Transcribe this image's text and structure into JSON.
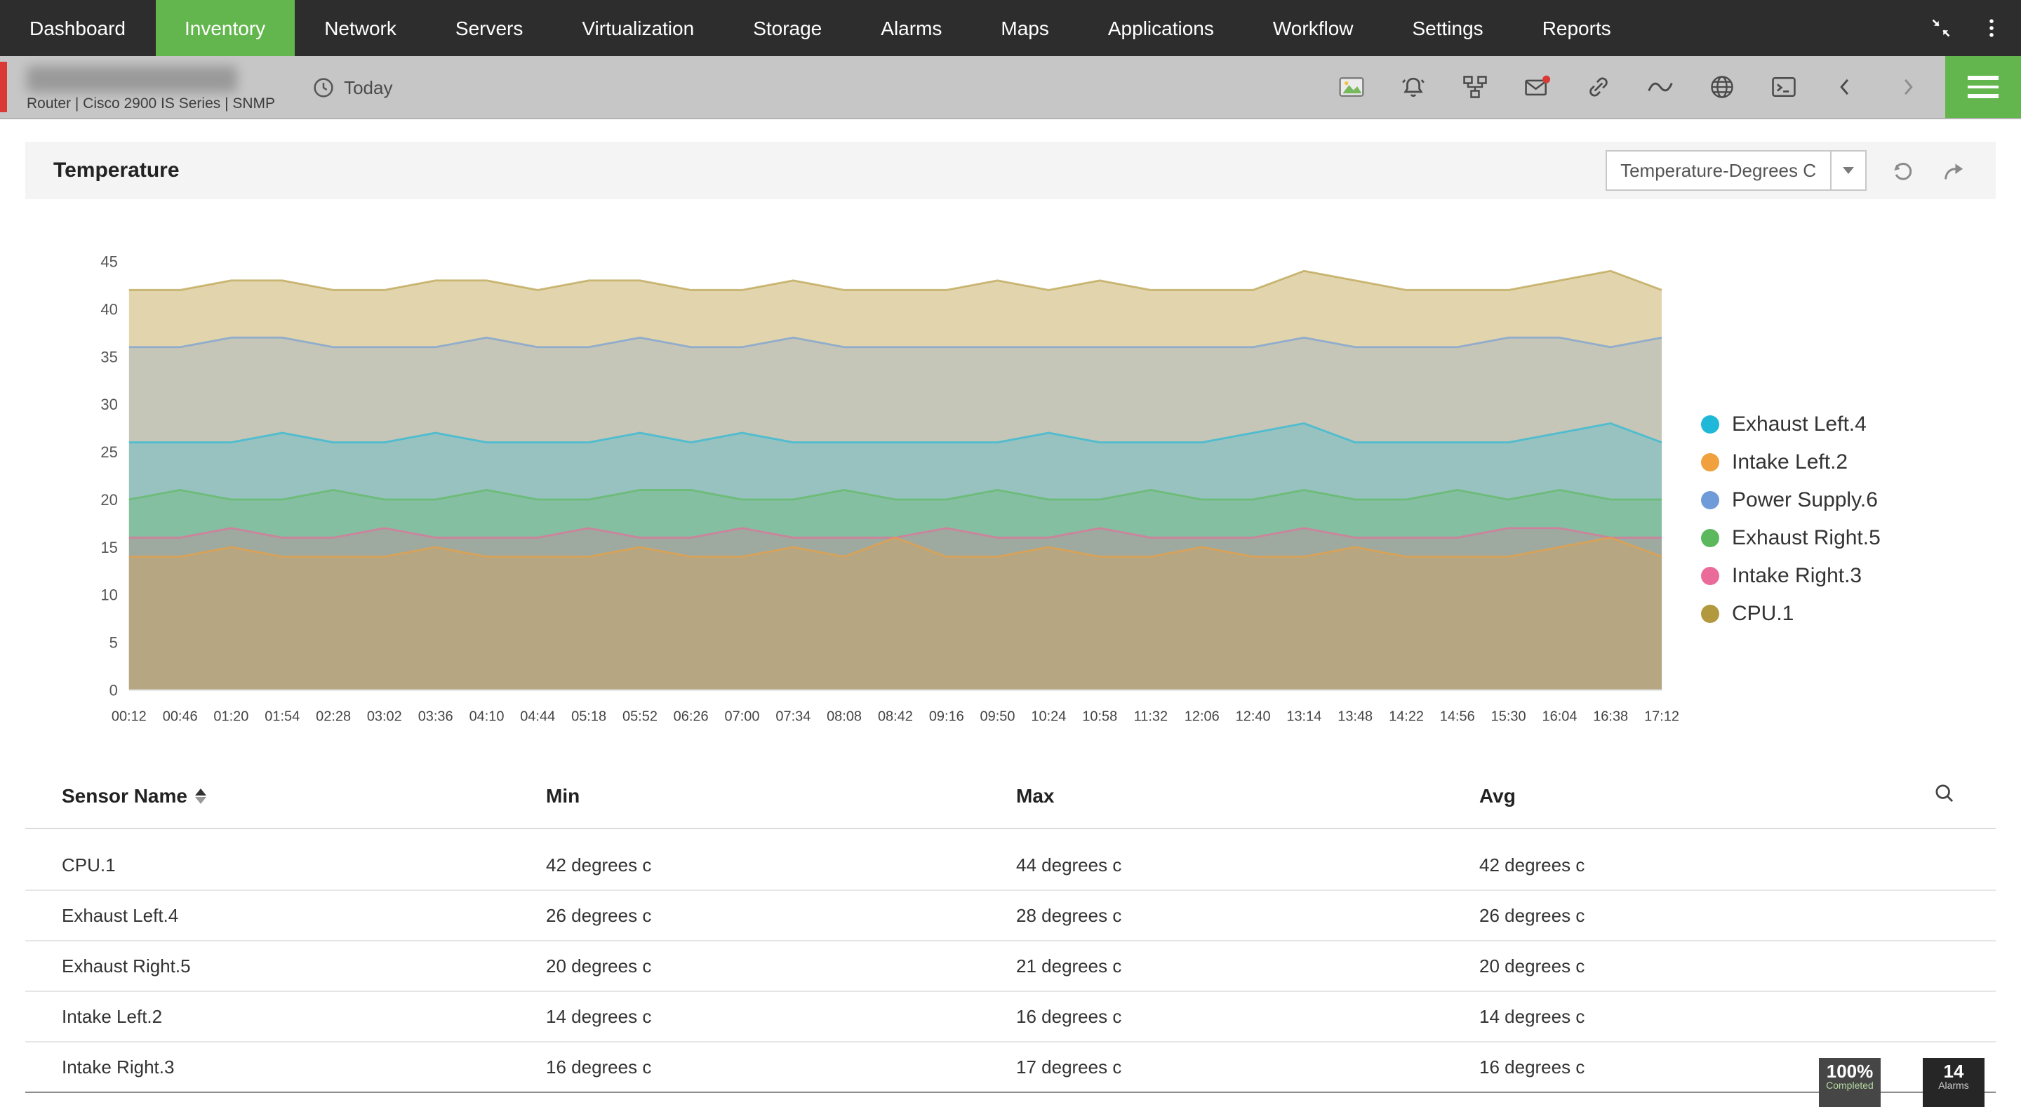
{
  "theme": {
    "accent_green": "#63b64d",
    "accent_red": "#d93a36",
    "nav_bg": "#2d2d2d",
    "subheader_bg": "#c6c6c6"
  },
  "nav": {
    "items": [
      "Dashboard",
      "Inventory",
      "Network",
      "Servers",
      "Virtualization",
      "Storage",
      "Alarms",
      "Maps",
      "Applications",
      "Workflow",
      "Settings",
      "Reports"
    ],
    "active": "Inventory",
    "icons": [
      "collapse-icon",
      "kebab-menu-icon"
    ]
  },
  "subheader": {
    "device_info": "Router | Cisco 2900 IS Series  | SNMP",
    "time_filter": "Today",
    "icons": [
      "image-icon",
      "alarm-bell-icon",
      "topology-icon",
      "mail-icon",
      "link-icon",
      "sparkline-icon",
      "globe-icon",
      "terminal-icon",
      "chevron-left-icon",
      "chevron-right-icon",
      "menu-icon"
    ],
    "mail_has_notification": true
  },
  "panel": {
    "title": "Temperature",
    "dropdown_value": "Temperature-Degrees C",
    "control_icons": [
      "refresh-icon",
      "export-icon"
    ]
  },
  "chart_data": {
    "type": "area",
    "title": "Temperature",
    "unit": "degrees C",
    "ylim": [
      0,
      45
    ],
    "yticks": [
      0,
      5,
      10,
      15,
      20,
      25,
      30,
      35,
      40,
      45
    ],
    "grid": false,
    "legend_position": "right",
    "x": [
      "00:12",
      "00:46",
      "01:20",
      "01:54",
      "02:28",
      "03:02",
      "03:36",
      "04:10",
      "04:44",
      "05:18",
      "05:52",
      "06:26",
      "07:00",
      "07:34",
      "08:08",
      "08:42",
      "09:16",
      "09:50",
      "10:24",
      "10:58",
      "11:32",
      "12:06",
      "12:40",
      "13:14",
      "13:48",
      "14:22",
      "14:56",
      "15:30",
      "16:04",
      "16:38",
      "17:12"
    ],
    "series": [
      {
        "name": "Exhaust Left.4",
        "color": "#1fb8d8",
        "fill": "rgba(31,184,216,0.28)",
        "values": [
          26,
          26,
          26,
          27,
          26,
          26,
          27,
          26,
          26,
          26,
          27,
          26,
          27,
          26,
          26,
          26,
          26,
          26,
          27,
          26,
          26,
          26,
          27,
          28,
          26,
          26,
          26,
          26,
          27,
          28,
          26
        ]
      },
      {
        "name": "Intake Left.2",
        "color": "#f0a03c",
        "fill": "rgba(240,160,60,0.30)",
        "values": [
          14,
          14,
          15,
          14,
          14,
          14,
          15,
          14,
          14,
          14,
          15,
          14,
          14,
          15,
          14,
          16,
          14,
          14,
          15,
          14,
          14,
          15,
          14,
          14,
          15,
          14,
          14,
          14,
          15,
          16,
          14
        ]
      },
      {
        "name": "Power Supply.6",
        "color": "#6f9bd8",
        "fill": "rgba(111,155,216,0.25)",
        "values": [
          36,
          36,
          37,
          37,
          36,
          36,
          36,
          37,
          36,
          36,
          37,
          36,
          36,
          37,
          36,
          36,
          36,
          36,
          36,
          36,
          36,
          36,
          36,
          37,
          36,
          36,
          36,
          37,
          37,
          36,
          37
        ]
      },
      {
        "name": "Exhaust Right.5",
        "color": "#5cb85c",
        "fill": "rgba(92,184,92,0.30)",
        "values": [
          20,
          21,
          20,
          20,
          21,
          20,
          20,
          21,
          20,
          20,
          21,
          21,
          20,
          20,
          21,
          20,
          20,
          21,
          20,
          20,
          21,
          20,
          20,
          21,
          20,
          20,
          21,
          20,
          21,
          20,
          20
        ]
      },
      {
        "name": "Intake Right.3",
        "color": "#ea6a9a",
        "fill": "rgba(234,106,154,0.25)",
        "values": [
          16,
          16,
          17,
          16,
          16,
          17,
          16,
          16,
          16,
          17,
          16,
          16,
          17,
          16,
          16,
          16,
          17,
          16,
          16,
          17,
          16,
          16,
          16,
          17,
          16,
          16,
          16,
          17,
          17,
          16,
          16
        ]
      },
      {
        "name": "CPU.1",
        "color": "#b3993d",
        "fill": "rgba(202,178,106,0.55)",
        "values": [
          42,
          42,
          43,
          43,
          42,
          42,
          43,
          43,
          42,
          43,
          43,
          42,
          42,
          43,
          42,
          42,
          42,
          43,
          42,
          43,
          42,
          42,
          42,
          44,
          43,
          42,
          42,
          42,
          43,
          44,
          42
        ]
      }
    ]
  },
  "table": {
    "columns": [
      "Sensor Name",
      "Min",
      "Max",
      "Avg"
    ],
    "sorted_by": "Sensor Name",
    "rows": [
      {
        "sensor": "CPU.1",
        "min": "42 degrees c",
        "max": "44 degrees c",
        "avg": "42 degrees c"
      },
      {
        "sensor": "Exhaust Left.4",
        "min": "26 degrees c",
        "max": "28 degrees c",
        "avg": "26 degrees c"
      },
      {
        "sensor": "Exhaust Right.5",
        "min": "20 degrees c",
        "max": "21 degrees c",
        "avg": "20 degrees c"
      },
      {
        "sensor": "Intake Left.2",
        "min": "14 degrees c",
        "max": "16 degrees c",
        "avg": "14 degrees c"
      },
      {
        "sensor": "Intake Right.3",
        "min": "16 degrees c",
        "max": "17 degrees c",
        "avg": "16 degrees c"
      }
    ]
  },
  "badges": {
    "completed": {
      "value": "100%",
      "label": "Completed"
    },
    "alarms": {
      "value": "14",
      "label": "Alarms"
    }
  }
}
